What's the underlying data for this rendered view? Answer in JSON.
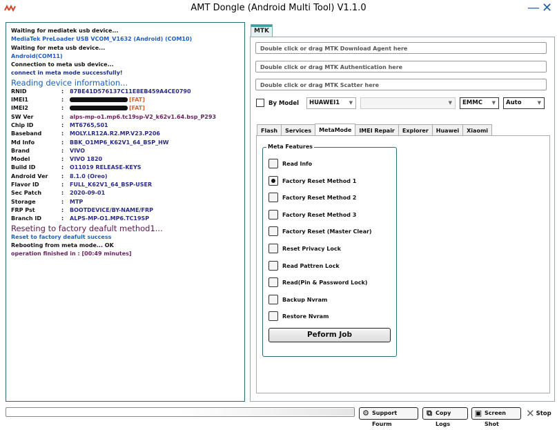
{
  "window": {
    "title": "AMT Dongle (Android Multi Tool) V1.1.0",
    "minimize_glyph": "—",
    "close_glyph": "✕"
  },
  "log": {
    "lines": [
      {
        "text": "Waiting for mediatek usb device...",
        "style": "blk"
      },
      {
        "text": "MediaTek PreLoader USB VCOM_V1632 (Android) (COM10)",
        "style": "blu"
      },
      {
        "text": "Waiting for meta usb device...",
        "style": "blk"
      },
      {
        "text": "Android(COM11)",
        "style": "blu"
      },
      {
        "text": "Connection to meta usb device...",
        "style": "blk"
      },
      {
        "text": "connect in meta mode successfully!",
        "style": "dkb"
      }
    ],
    "reading_heading": "Reading device information...",
    "fields": [
      {
        "key": "RNID",
        "value": "87BE41D576137C11E8EB459A4CE0790"
      },
      {
        "key": "IMEI1",
        "value": "[FAT]",
        "redacted": true
      },
      {
        "key": "IMEI2",
        "value": "[FAT]",
        "redacted": true
      },
      {
        "key": "SW Ver",
        "value": "alps-mp-o1.mp6.tc19sp-V2_k62v1.64.bsp_P293",
        "purple": true
      },
      {
        "key": "Chip ID",
        "value": "MT6765,S01"
      },
      {
        "key": "Baseband",
        "value": "MOLY.LR12A.R2.MP.V23.P206"
      },
      {
        "key": "Md Info",
        "value": "BBK_O1MP6_K62V1_64_BSP_HW"
      },
      {
        "key": "Brand",
        "value": "VIVO"
      },
      {
        "key": "Model",
        "value": "VIVO 1820"
      },
      {
        "key": "Build ID",
        "value": "O11019 RELEASE-KEYS"
      },
      {
        "key": "Android Ver",
        "value": "8.1.0 (Oreo)"
      },
      {
        "key": "Flavor ID",
        "value": "FULL_K62V1_64_BSP-USER"
      },
      {
        "key": "Sec Patch",
        "value": "2020-09-01"
      },
      {
        "key": "Storage",
        "value": "MTP"
      },
      {
        "key": "FRP Pst",
        "value": "BOOTDEVICE/BY-NAME/FRP"
      },
      {
        "key": "Branch ID",
        "value": "ALPS-MP-O1.MP6.TC19SP"
      }
    ],
    "reset_heading": "Reseting to factory deafult method1...",
    "tail": [
      {
        "text": "Reset to factory deafult success",
        "style": "blu"
      },
      {
        "text": "Rebooting from meta mode...",
        "suffix": " OK",
        "style": "blk"
      },
      {
        "text": "operation finished in : [00:49 minutes]",
        "style": "pur"
      }
    ],
    "separator": ":"
  },
  "mtk_tab": {
    "label": "MTK"
  },
  "inputs": {
    "download_agent": "Double click or drag MTK Download Agent here",
    "authentication": "Double click or drag MTK Authentication here",
    "scatter": "Double click or drag MTK Scatter here"
  },
  "model_row": {
    "by_model_label": "By Model",
    "brand": "HUAWEI1",
    "model": "",
    "storage": "EMMC",
    "mode": "Auto"
  },
  "subtabs": [
    "Flash",
    "Services",
    "MetaMode",
    "IMEI Repair",
    "Explorer",
    "Huawei",
    "Xiaomi"
  ],
  "active_subtab": "MetaMode",
  "meta": {
    "group_title": "Meta Features",
    "options": [
      {
        "label": "Read Info",
        "checked": false
      },
      {
        "label": "Factory Reset Method 1",
        "checked": true
      },
      {
        "label": "Factory Reset Method 2",
        "checked": false
      },
      {
        "label": "Factory Reset Method 3",
        "checked": false
      },
      {
        "label": "Factory Reset (Master Clear)",
        "checked": false
      },
      {
        "label": "Reset Privacy Lock",
        "checked": false
      },
      {
        "label": "Read Pattren Lock",
        "checked": false
      },
      {
        "label": "Read(Pin & Password Lock)",
        "checked": false
      },
      {
        "label": "Backup Nvram",
        "checked": false
      },
      {
        "label": "Restore Nvram",
        "checked": false
      }
    ],
    "perform_label": "Peform Job"
  },
  "bottom": {
    "progress_fraction": 0.0,
    "support_label": "Support Fourm",
    "copy_logs_label": "Copy Logs",
    "screenshot_label": "Screen Shot",
    "stop_label": "Stop"
  },
  "colors": {
    "accent": "#1e5fa8",
    "border_teal": "#2e6b78",
    "fat": "#e0622a"
  }
}
